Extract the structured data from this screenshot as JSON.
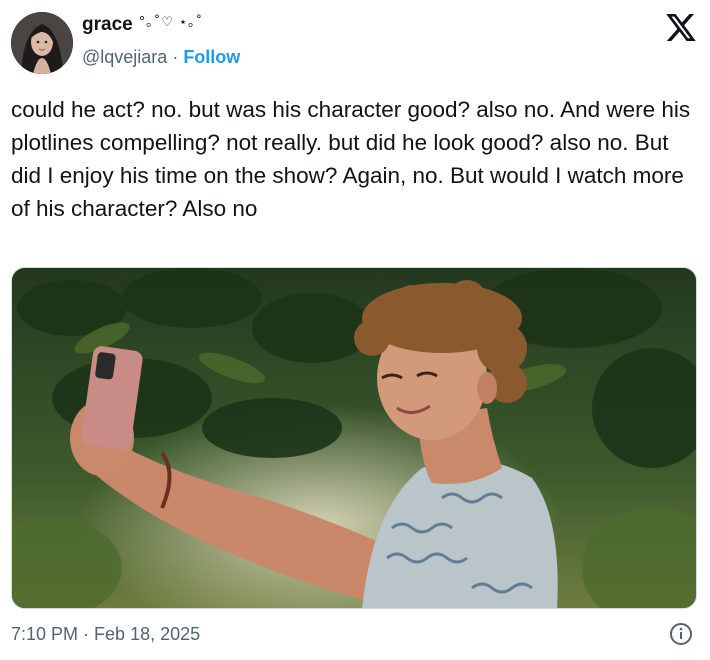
{
  "user": {
    "display_name": "grace",
    "name_decoration": "°｡˚♡ ⋆｡˚",
    "handle": "@lqvejiara",
    "separator": "·",
    "follow_label": "Follow"
  },
  "tweet": {
    "text": "could he act? no. but was his character good? also no. And were his plotlines compelling? not really. but did he look good? also no. But did I enjoy his time on the show? Again, no. But would I watch more of his character? Also no"
  },
  "meta": {
    "time": "7:10 PM",
    "separator": "·",
    "date": "Feb 18, 2025"
  },
  "icons": {
    "brand": "x-logo-icon",
    "info": "info-icon"
  },
  "colors": {
    "text": "#0f1419",
    "secondary": "#536471",
    "accent": "#1d9bf0",
    "border": "#cfd9de"
  }
}
